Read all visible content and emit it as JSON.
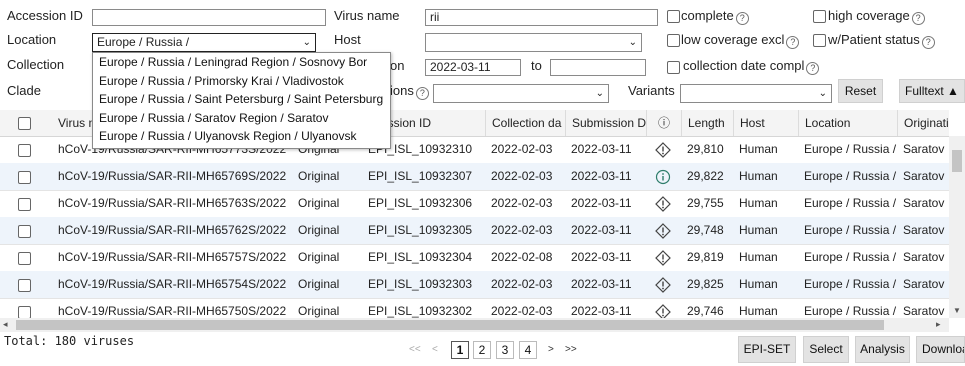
{
  "filters": {
    "accession_id": {
      "label": "Accession ID",
      "value": ""
    },
    "virus_name": {
      "label": "Virus name",
      "value": "rii"
    },
    "location": {
      "label": "Location",
      "value": "Europe / Russia /"
    },
    "host": {
      "label": "Host",
      "value": ""
    },
    "collection": {
      "label": "Collection",
      "from_suffix": "on",
      "from_value": "2022-03-11",
      "to_label": "to",
      "to_value": ""
    },
    "clade": {
      "label": "Clade",
      "value": ""
    },
    "mutations": {
      "label_suffix": "ions",
      "value": ""
    },
    "variants": {
      "label": "Variants",
      "value": ""
    },
    "checkboxes": {
      "complete": "complete",
      "high_coverage": "high coverage",
      "low_coverage_excl": "low coverage excl",
      "patient_status": "w/Patient status",
      "collection_date_complete": "collection date compl"
    },
    "reset_label": "Reset",
    "fulltext_label": "Fulltext ▲"
  },
  "location_dropdown": [
    "Europe / Russia / Leningrad Region / Sosnovy Bor",
    "Europe / Russia / Primorsky Krai / Vladivostok",
    "Europe / Russia / Saint Petersburg / Saint Petersburg",
    "Europe / Russia / Saratov Region / Saratov",
    "Europe / Russia / Ulyanovsk Region / Ulyanovsk"
  ],
  "table": {
    "columns": [
      "Virus n",
      "",
      "ccession ID",
      "Collection da",
      "Submission D",
      "ⓘ",
      "Length",
      "Host",
      "Location",
      "Originating"
    ],
    "rows": [
      {
        "virus": "hCoV-19/Russia/SAR-RII-MH65773S/2022",
        "passage": "Original",
        "accession": "EPI_ISL_10932310",
        "collection": "2022-02-03",
        "submission": "2022-03-11",
        "flag": "warn",
        "length": "29,810",
        "host": "Human",
        "location": "Europe / Russia /",
        "originating": "Saratov"
      },
      {
        "virus": "hCoV-19/Russia/SAR-RII-MH65769S/2022",
        "passage": "Original",
        "accession": "EPI_ISL_10932307",
        "collection": "2022-02-03",
        "submission": "2022-03-11",
        "flag": "info",
        "length": "29,822",
        "host": "Human",
        "location": "Europe / Russia /",
        "originating": "Saratov"
      },
      {
        "virus": "hCoV-19/Russia/SAR-RII-MH65763S/2022",
        "passage": "Original",
        "accession": "EPI_ISL_10932306",
        "collection": "2022-02-03",
        "submission": "2022-03-11",
        "flag": "warn",
        "length": "29,755",
        "host": "Human",
        "location": "Europe / Russia /",
        "originating": "Saratov"
      },
      {
        "virus": "hCoV-19/Russia/SAR-RII-MH65762S/2022",
        "passage": "Original",
        "accession": "EPI_ISL_10932305",
        "collection": "2022-02-03",
        "submission": "2022-03-11",
        "flag": "warn",
        "length": "29,748",
        "host": "Human",
        "location": "Europe / Russia /",
        "originating": "Saratov"
      },
      {
        "virus": "hCoV-19/Russia/SAR-RII-MH65757S/2022",
        "passage": "Original",
        "accession": "EPI_ISL_10932304",
        "collection": "2022-02-08",
        "submission": "2022-03-11",
        "flag": "warn",
        "length": "29,819",
        "host": "Human",
        "location": "Europe / Russia /",
        "originating": "Saratov"
      },
      {
        "virus": "hCoV-19/Russia/SAR-RII-MH65754S/2022",
        "passage": "Original",
        "accession": "EPI_ISL_10932303",
        "collection": "2022-02-03",
        "submission": "2022-03-11",
        "flag": "warn",
        "length": "29,825",
        "host": "Human",
        "location": "Europe / Russia /",
        "originating": "Saratov"
      },
      {
        "virus": "hCoV-19/Russia/SAR-RII-MH65750S/2022",
        "passage": "Original",
        "accession": "EPI_ISL_10932302",
        "collection": "2022-02-03",
        "submission": "2022-03-11",
        "flag": "warn",
        "length": "29,746",
        "host": "Human",
        "location": "Europe / Russia /",
        "originating": "Saratov"
      }
    ]
  },
  "footer": {
    "total": "Total: 180 viruses",
    "pager": {
      "first": "<<",
      "prev": "<",
      "pages": [
        "1",
        "2",
        "3",
        "4"
      ],
      "next": ">",
      "last": ">>"
    },
    "buttons": {
      "epiSet": "EPI-SET",
      "select": "Select",
      "analysis": "Analysis",
      "download": "Download"
    }
  },
  "icons": {
    "help": "help-circle-icon",
    "warning": "warning-diamond-icon",
    "info": "info-circle-icon"
  }
}
